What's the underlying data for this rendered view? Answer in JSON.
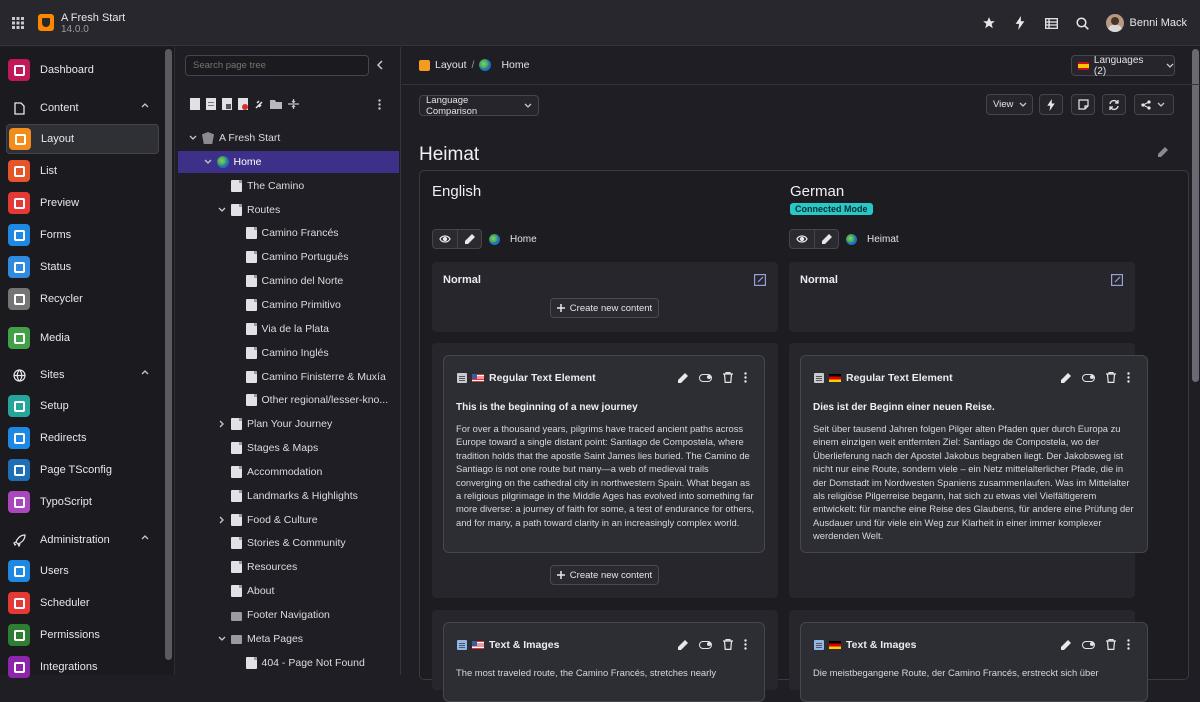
{
  "app": {
    "title": "A Fresh Start",
    "version": "14.0.0"
  },
  "user": {
    "name": "Benni Mack"
  },
  "topbar_icons": [
    "star-icon",
    "bolt-icon",
    "list-icon",
    "search-icon"
  ],
  "modules": [
    {
      "key": "dashboard",
      "label": "Dashboard",
      "color": "#c2185b"
    },
    {
      "group": true,
      "key": "content",
      "label": "Content",
      "icon": "document-icon"
    },
    {
      "key": "layout",
      "label": "Layout",
      "color": "#f28c1b",
      "active": true
    },
    {
      "key": "list",
      "label": "List",
      "color": "#e8542a"
    },
    {
      "key": "preview",
      "label": "Preview",
      "color": "#e53935"
    },
    {
      "key": "forms",
      "label": "Forms",
      "color": "#1e88e5"
    },
    {
      "key": "status",
      "label": "Status",
      "color": "#2f8ae0"
    },
    {
      "key": "recycler",
      "label": "Recycler",
      "color": "#757575"
    },
    {
      "key": "media",
      "label": "Media",
      "color": "#43a047"
    },
    {
      "group": true,
      "key": "sites",
      "label": "Sites",
      "icon": "globe-icon"
    },
    {
      "key": "setup",
      "label": "Setup",
      "color": "#26a69a"
    },
    {
      "key": "redirects",
      "label": "Redirects",
      "color": "#1e88e5"
    },
    {
      "key": "pagetsconfig",
      "label": "Page TSconfig",
      "color": "#1e6fb8"
    },
    {
      "key": "typoscript",
      "label": "TypoScript",
      "color": "#ab47bc"
    },
    {
      "group": true,
      "key": "administration",
      "label": "Administration",
      "icon": "rocket-icon"
    },
    {
      "key": "users",
      "label": "Users",
      "color": "#1e88e5"
    },
    {
      "key": "scheduler",
      "label": "Scheduler",
      "color": "#e53935"
    },
    {
      "key": "permissions",
      "label": "Permissions",
      "color": "#2e7d32"
    },
    {
      "key": "integrations",
      "label": "Integrations",
      "color": "#8e24aa"
    }
  ],
  "pagetree": {
    "search_placeholder": "Search page tree",
    "toolbar_icons": [
      "new-page-icon",
      "new-page-text-icon",
      "new-page-image-icon",
      "new-page-link-icon",
      "link-icon",
      "folder-icon",
      "divider-icon"
    ],
    "nodes": [
      {
        "label": "A Fresh Start",
        "level": 0,
        "type": "root",
        "expanded": true
      },
      {
        "label": "Home",
        "level": 1,
        "type": "globe",
        "expanded": true,
        "selected": true
      },
      {
        "label": "The Camino",
        "level": 2,
        "type": "page"
      },
      {
        "label": "Routes",
        "level": 2,
        "type": "page",
        "expanded": true
      },
      {
        "label": "Camino Francés",
        "level": 3,
        "type": "page"
      },
      {
        "label": "Camino Português",
        "level": 3,
        "type": "page"
      },
      {
        "label": "Camino del Norte",
        "level": 3,
        "type": "page"
      },
      {
        "label": "Camino Primitivo",
        "level": 3,
        "type": "page"
      },
      {
        "label": "Via de la Plata",
        "level": 3,
        "type": "page"
      },
      {
        "label": "Camino Inglés",
        "level": 3,
        "type": "page"
      },
      {
        "label": "Camino Finisterre & Muxía",
        "level": 3,
        "type": "page"
      },
      {
        "label": "Other regional/lesser-kno...",
        "level": 3,
        "type": "page"
      },
      {
        "label": "Plan Your Journey",
        "level": 2,
        "type": "page",
        "collapsed": true
      },
      {
        "label": "Stages & Maps",
        "level": 2,
        "type": "page"
      },
      {
        "label": "Accommodation",
        "level": 2,
        "type": "page"
      },
      {
        "label": "Landmarks & Highlights",
        "level": 2,
        "type": "page"
      },
      {
        "label": "Food & Culture",
        "level": 2,
        "type": "page",
        "collapsed": true
      },
      {
        "label": "Stories & Community",
        "level": 2,
        "type": "page"
      },
      {
        "label": "Resources",
        "level": 2,
        "type": "page"
      },
      {
        "label": "About",
        "level": 2,
        "type": "page"
      },
      {
        "label": "Footer Navigation",
        "level": 2,
        "type": "folder"
      },
      {
        "label": "Meta Pages",
        "level": 2,
        "type": "folder",
        "expanded": true
      },
      {
        "label": "404 - Page Not Found",
        "level": 3,
        "type": "page"
      }
    ]
  },
  "breadcrumb": {
    "module": "Layout",
    "separator": "/",
    "page": "Home"
  },
  "languages_button": "Languages (2)",
  "view_mode": "Language Comparison",
  "view_button": "View",
  "page_title": "Heimat",
  "columns": [
    {
      "language": "English",
      "page_label": "Home",
      "colpos_title": "Normal",
      "create_label": "Create new content",
      "flag": "us",
      "cards": [
        {
          "type": "Regular Text Element",
          "title": "This is the beginning of a new journey",
          "text": "For over a thousand years, pilgrims have traced ancient paths across Europe toward a single distant point: Santiago de Compostela, where tradition holds that the apostle Saint James lies buried. The Camino de Santiago is not one route but many—a web of medieval trails converging on the cathedral city in northwestern Spain. What began as a religious pilgrimage in the Middle Ages has evolved into something far more diverse: a journey of faith for some, a test of endurance for others, and for many, a path toward clarity in an increasingly complex world."
        },
        {
          "type": "Text & Images",
          "title": "",
          "text": "The most traveled route, the Camino Francés, stretches nearly"
        }
      ]
    },
    {
      "language": "German",
      "badge": "Connected Mode",
      "page_label": "Heimat",
      "colpos_title": "Normal",
      "flag": "de",
      "cards": [
        {
          "type": "Regular Text Element",
          "title": "Dies ist der Beginn einer neuen Reise.",
          "text": "Seit über tausend Jahren folgen Pilger alten Pfaden quer durch Europa zu einem einzigen weit entfernten Ziel: Santiago de Compostela, wo der Überlieferung nach der Apostel Jakobus begraben liegt. Der Jakobsweg ist nicht nur eine Route, sondern viele – ein Netz mittelalterlicher Pfade, die in der Domstadt im Nordwesten Spaniens zusammenlaufen. Was im Mittelalter als religiöse Pilgerreise begann, hat sich zu etwas viel Vielfältigerem entwickelt: für manche eine Reise des Glaubens, für andere eine Prüfung der Ausdauer und für viele ein Weg zur Klarheit in einer immer komplexer werdenden Welt."
        },
        {
          "type": "Text & Images",
          "title": "",
          "text": "Die meistbegangene Route, der Camino Francés, erstreckt sich über"
        }
      ]
    }
  ]
}
